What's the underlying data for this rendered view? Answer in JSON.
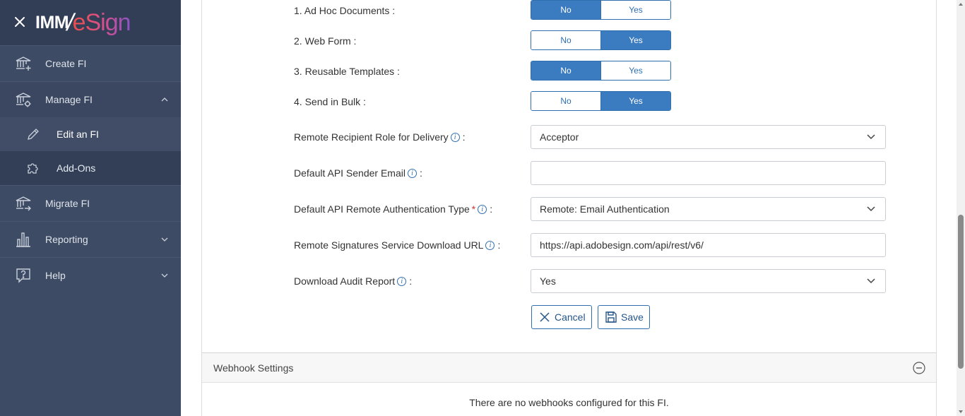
{
  "sidebar": {
    "logo": {
      "part1": "IMM",
      "slash": "/",
      "part2": "eSign"
    },
    "items": [
      {
        "label": "Create FI",
        "icon": "bank-plus-icon"
      },
      {
        "label": "Manage FI",
        "icon": "bank-gear-icon",
        "expanded": true
      },
      {
        "label": "Edit an FI",
        "icon": "pencil-icon",
        "sub": true,
        "active": true
      },
      {
        "label": "Add-Ons",
        "icon": "puzzle-icon",
        "sub": true
      },
      {
        "label": "Migrate FI",
        "icon": "bank-arrow-icon"
      },
      {
        "label": "Reporting",
        "icon": "bar-chart-icon"
      },
      {
        "label": "Help",
        "icon": "question-bubble-icon"
      }
    ]
  },
  "form": {
    "features": [
      {
        "label": "1. Ad Hoc Documents :",
        "no": "No",
        "yes": "Yes",
        "selected": "No"
      },
      {
        "label": "2. Web Form :",
        "no": "No",
        "yes": "Yes",
        "selected": "Yes"
      },
      {
        "label": "3. Reusable Templates :",
        "no": "No",
        "yes": "Yes",
        "selected": "No"
      },
      {
        "label": "4. Send in Bulk :",
        "no": "No",
        "yes": "Yes",
        "selected": "Yes"
      }
    ],
    "fields": [
      {
        "label": "Remote Recipient Role for Delivery",
        "value": "Acceptor",
        "type": "select"
      },
      {
        "label": "Default API Sender Email",
        "value": "",
        "type": "text"
      },
      {
        "label": "Default API Remote Authentication Type",
        "required": "*",
        "value": "Remote: Email Authentication",
        "type": "select"
      },
      {
        "label": "Remote Signatures Service Download URL",
        "value": "https://api.adobesign.com/api/rest/v6/",
        "type": "text"
      },
      {
        "label": "Download Audit Report",
        "value": "Yes",
        "type": "select"
      }
    ],
    "colon": ":",
    "info_glyph": "i",
    "cancel_label": "Cancel",
    "save_label": "Save"
  },
  "webhooks": {
    "title": "Webhook Settings",
    "empty_message": "There are no webhooks configured for this FI."
  },
  "colors": {
    "sidebar_bg": "#3e4b64",
    "accent": "#3b7bc0",
    "required": "#dd3333"
  }
}
